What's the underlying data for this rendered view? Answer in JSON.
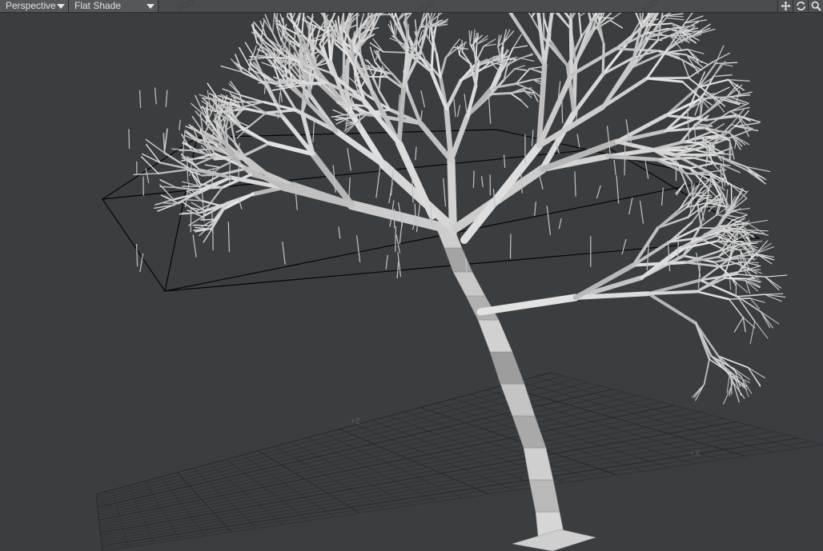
{
  "toolbar": {
    "view_mode": "Perspective",
    "shade_mode": "Flat Shade",
    "icons": [
      "move-view-icon",
      "rotate-view-icon",
      "zoom-view-icon"
    ]
  },
  "viewport": {
    "axis_labels": {
      "z": "+Z",
      "x": "+X"
    },
    "watermark": "MOO"
  },
  "colors": {
    "background": "#3b3e41",
    "grid": "#2c2f32",
    "mesh": "#c9c9c9",
    "bounding_box": "#000000"
  }
}
